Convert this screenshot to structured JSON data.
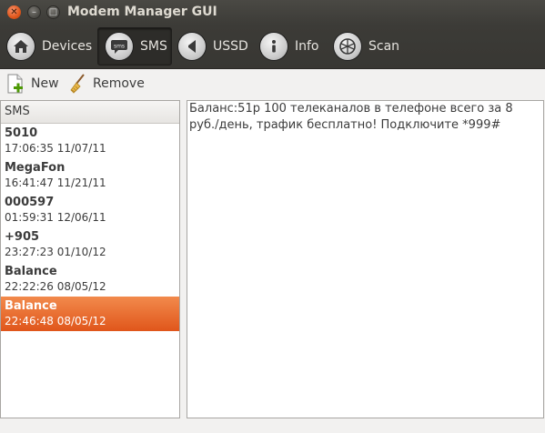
{
  "window": {
    "title": "Modem Manager GUI"
  },
  "toolbar": {
    "items": [
      {
        "label": "Devices",
        "icon": "home-icon"
      },
      {
        "label": "SMS",
        "icon": "sms-icon",
        "active": true
      },
      {
        "label": "USSD",
        "icon": "speaker-icon"
      },
      {
        "label": "Info",
        "icon": "info-icon"
      },
      {
        "label": "Scan",
        "icon": "network-icon"
      }
    ]
  },
  "actions": {
    "new_label": "New",
    "remove_label": "Remove"
  },
  "sms_list": {
    "header": "SMS",
    "items": [
      {
        "sender": "5010",
        "time": "17:06:35 11/07/11"
      },
      {
        "sender": "MegaFon",
        "time": "16:41:47 11/21/11"
      },
      {
        "sender": "000597",
        "time": "01:59:31 12/06/11"
      },
      {
        "sender": "+905",
        "time": "23:27:23 01/10/12"
      },
      {
        "sender": "Balance",
        "time": "22:22:26 08/05/12"
      },
      {
        "sender": "Balance",
        "time": "22:46:48 08/05/12",
        "selected": true
      }
    ]
  },
  "message": {
    "text": "Баланс:51р 100 телеканалов в телефоне всего за 8 руб./день, трафик бесплатно! Подключите *999#"
  },
  "colors": {
    "selection": "#e0561b",
    "toolbar_bg": "#3c3b37"
  }
}
